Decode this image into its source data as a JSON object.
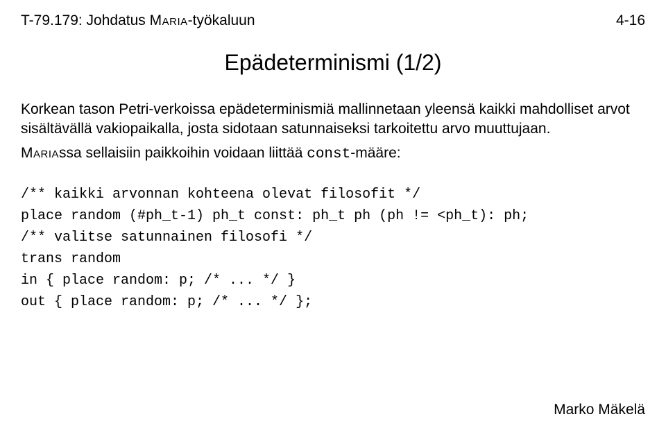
{
  "header": {
    "left_course": "T-79.179: Johdatus ",
    "left_tool_smallcaps": "Maria",
    "left_suffix": "-työkaluun",
    "right": "4-16"
  },
  "title": "Epädeterminismi (1/2)",
  "para1": "Korkean tason Petri-verkoissa epädeterminismiä mallinnetaan yleensä kaikki mahdolliset arvot sisältävällä vakiopaikalla, josta sidotaan satunnaiseksi tarkoitettu arvo muuttujaan.",
  "para2_pre": "",
  "para2_smallcaps": "Maria",
  "para2_mid": "ssa sellaisiin paikkoihin voidaan liittää ",
  "para2_mono": "const",
  "para2_post": "-määre:",
  "code": {
    "l1": "/** kaikki arvonnan kohteena olevat filosofit */",
    "l2": "place random (#ph_t-1) ph_t const: ph_t ph (ph != <ph_t): ph;",
    "l3": "/** valitse satunnainen filosofi */",
    "l4": "trans random",
    "l5": "in { place random: p; /* ... */ }",
    "l6": "out { place random: p; /* ... */ };"
  },
  "footer": "Marko Mäkelä"
}
